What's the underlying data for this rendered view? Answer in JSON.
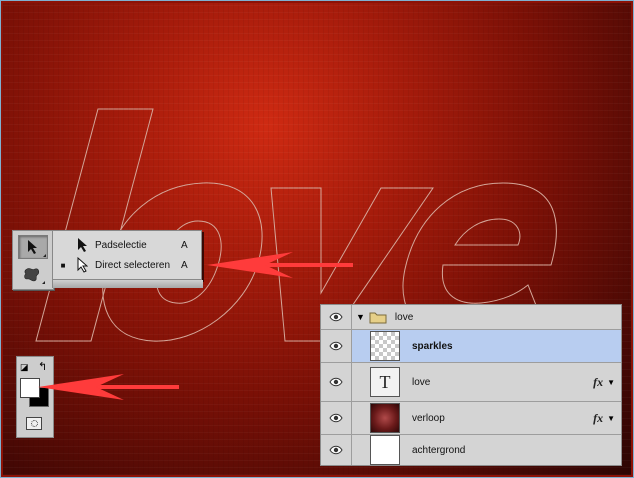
{
  "tools": {
    "active": "path-selection",
    "items": [
      {
        "name": "path-selection-tool",
        "icon": "black-arrow-icon"
      },
      {
        "name": "custom-shape-tool",
        "icon": "shape-blob-icon"
      }
    ]
  },
  "flyout": {
    "items": [
      {
        "label": "Padselectie",
        "key": "A",
        "checked": false,
        "icon": "black-arrow-icon"
      },
      {
        "label": "Direct selecteren",
        "key": "A",
        "checked": true,
        "icon": "white-arrow-icon"
      }
    ],
    "bullet": "■"
  },
  "swatches": {
    "foreground": "#ffffff",
    "background": "#000000",
    "swap_glyph": "↰",
    "default_glyph": "◪"
  },
  "layers": {
    "group": {
      "name": "love",
      "caret": "▼"
    },
    "rows": [
      {
        "name": "sparkles",
        "thumb": "transparent",
        "selected": true,
        "fx": false
      },
      {
        "name": "love",
        "thumb": "text",
        "thumb_glyph": "T",
        "selected": false,
        "fx": true
      },
      {
        "name": "verloop",
        "thumb": "gradient",
        "selected": false,
        "fx": true
      },
      {
        "name": "achtergrond",
        "thumb": "white",
        "selected": false,
        "fx": false
      }
    ],
    "fx_label": "fx",
    "fx_caret": "▼"
  },
  "colors": {
    "arrow": "#ff3b3b",
    "selected_row": "#b8cdf0"
  }
}
